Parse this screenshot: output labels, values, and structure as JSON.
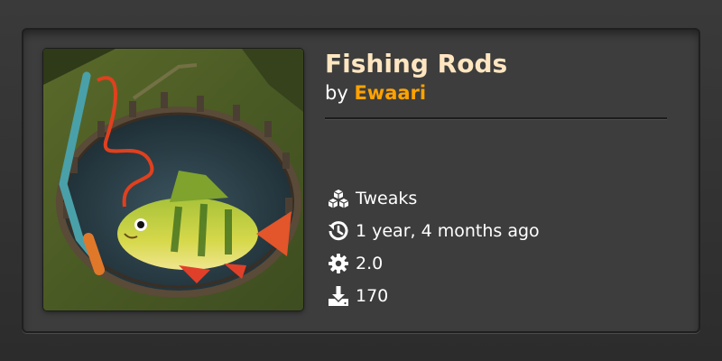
{
  "mod": {
    "title": "Fishing Rods",
    "by_prefix": "by",
    "author": "Ewaari",
    "category": "Tweaks",
    "updated": "1 year, 4 months ago",
    "version": "2.0",
    "downloads": "170"
  },
  "icons": {
    "category": "cubes-icon",
    "updated": "history-icon",
    "version": "gear-icon",
    "downloads": "download-icon"
  },
  "colors": {
    "title": "#ffe6c0",
    "author": "#ffa200",
    "text": "#ffffff",
    "card_bg": "#3d3d3d"
  }
}
